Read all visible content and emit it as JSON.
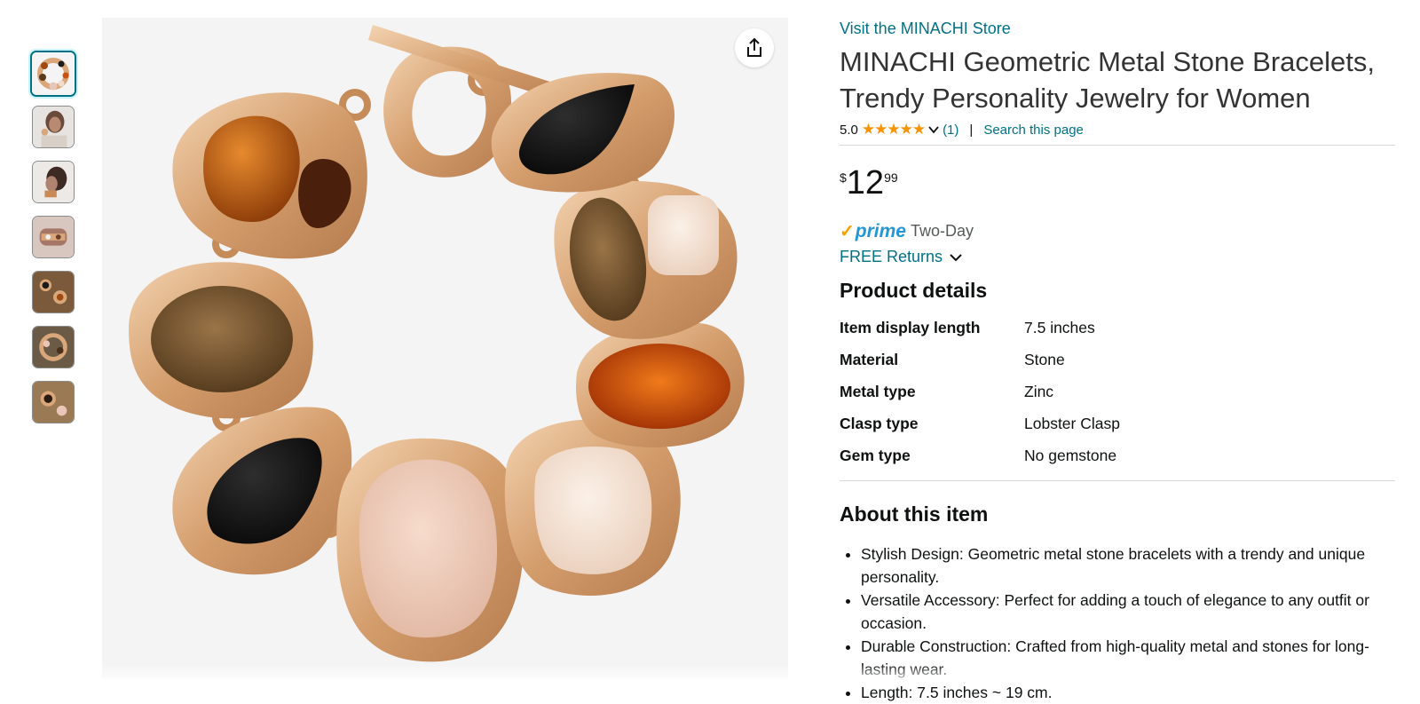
{
  "store": {
    "link_text": "Visit the MINACHI Store"
  },
  "product": {
    "title": "MINACHI Geometric Metal Stone Bracelets, Trendy Personality Jewelry for Women",
    "rating_value": "5.0",
    "stars": "★★★★★",
    "rating_count": "(1)",
    "search_link": "Search this page"
  },
  "price": {
    "currency": "$",
    "whole": "12",
    "fraction": "99"
  },
  "delivery": {
    "prime_check": "✓",
    "prime_label": "prime",
    "prime_speed": "Two-Day",
    "returns_label": "FREE Returns"
  },
  "details": {
    "heading": "Product details",
    "rows": [
      {
        "label": "Item display length",
        "value": "7.5 inches"
      },
      {
        "label": "Material",
        "value": "Stone"
      },
      {
        "label": "Metal type",
        "value": "Zinc"
      },
      {
        "label": "Clasp type",
        "value": "Lobster Clasp"
      },
      {
        "label": "Gem type",
        "value": "No gemstone"
      }
    ]
  },
  "about": {
    "heading": "About this item",
    "bullets": [
      "Stylish Design: Geometric metal stone bracelets with a trendy and unique personality.",
      "Versatile Accessory: Perfect for adding a touch of elegance to any outfit or occasion.",
      "Durable Construction: Crafted from high-quality metal and stones for long-lasting wear.",
      "Length: 7.5 inches ~ 19 cm."
    ]
  },
  "thumbnails": [
    {
      "name": "bracelet-main",
      "active": true
    },
    {
      "name": "model-wearing-1",
      "active": false
    },
    {
      "name": "model-wearing-2",
      "active": false
    },
    {
      "name": "wrist-closeup",
      "active": false
    },
    {
      "name": "bracelet-detail-1",
      "active": false
    },
    {
      "name": "bracelet-detail-2",
      "active": false
    },
    {
      "name": "bracelet-detail-3",
      "active": false
    }
  ],
  "colors": {
    "link": "#007185",
    "star": "#f59300",
    "prime_blue": "#2496d6",
    "prime_check": "#f7a100",
    "thumb_active_border": "#007185",
    "gold": "#d9a77a"
  },
  "icons": {
    "share": "share-icon",
    "rating_dropdown": "chevron-down-icon",
    "returns_dropdown": "chevron-down-icon"
  }
}
